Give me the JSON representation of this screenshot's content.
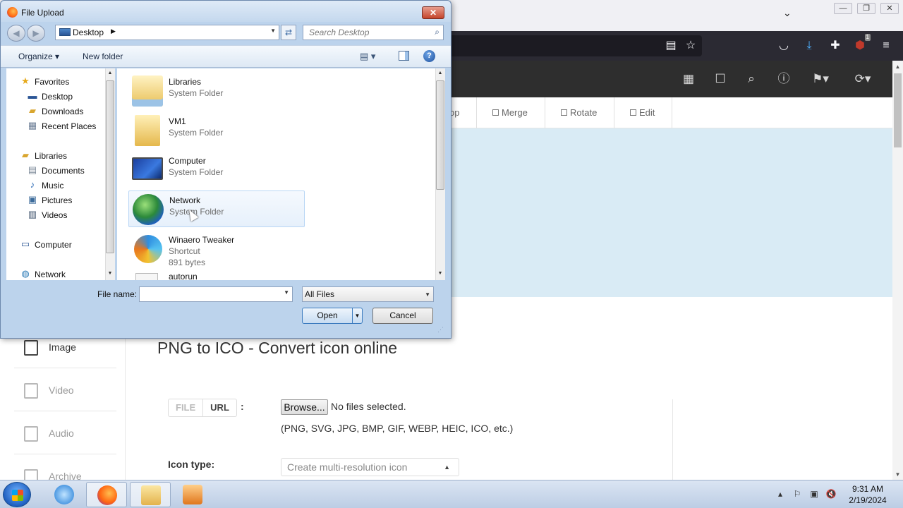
{
  "browser": {
    "window_buttons": [
      "—",
      "❐",
      "✕"
    ],
    "tabs_chevron": "⌄",
    "extension_badge": "1"
  },
  "site": {
    "tool_tabs": [
      {
        "label": "op"
      },
      {
        "label": "Merge"
      },
      {
        "label": "Rotate"
      },
      {
        "label": "Edit"
      }
    ],
    "left_menu": [
      {
        "label": "Image",
        "icon": "image-icon",
        "active": true
      },
      {
        "label": "Video",
        "icon": "video-icon",
        "active": false
      },
      {
        "label": "Audio",
        "icon": "audio-icon",
        "active": false
      },
      {
        "label": "Archive",
        "icon": "archive-icon",
        "active": false
      }
    ],
    "heading": "PNG to ICO - Convert icon online",
    "source_tabs": {
      "file": "FILE",
      "url": "URL",
      "colon": ":"
    },
    "browse_label": "Browse...",
    "no_files": "No files selected.",
    "formats": "(PNG, SVG, JPG, BMP, GIF, WEBP, HEIC, ICO, etc.)",
    "icon_type_label": "Icon type:",
    "icon_type_value": "Create multi-resolution icon"
  },
  "dialog": {
    "title": "File Upload",
    "address": "Desktop",
    "search_placeholder": "Search Desktop",
    "organize_label": "Organize",
    "new_folder_label": "New folder",
    "nav_pane": {
      "favorites": "Favorites",
      "desktop": "Desktop",
      "downloads": "Downloads",
      "recent_places": "Recent Places",
      "libraries": "Libraries",
      "documents": "Documents",
      "music": "Music",
      "pictures": "Pictures",
      "videos": "Videos",
      "computer": "Computer",
      "network": "Network"
    },
    "files": [
      {
        "name": "Libraries",
        "type": "System Folder"
      },
      {
        "name": "VM1",
        "type": "System Folder"
      },
      {
        "name": "Computer",
        "type": "System Folder"
      },
      {
        "name": "Network",
        "type": "System Folder"
      },
      {
        "name": "Winaero Tweaker",
        "type": "Shortcut",
        "size": "891 bytes"
      },
      {
        "name": "autorun",
        "type": ""
      }
    ],
    "file_name_label": "File name:",
    "file_name_value": "",
    "file_type_value": "All Files",
    "open_label": "Open",
    "cancel_label": "Cancel"
  },
  "taskbar": {
    "time": "9:31 AM",
    "date": "2/19/2024"
  }
}
